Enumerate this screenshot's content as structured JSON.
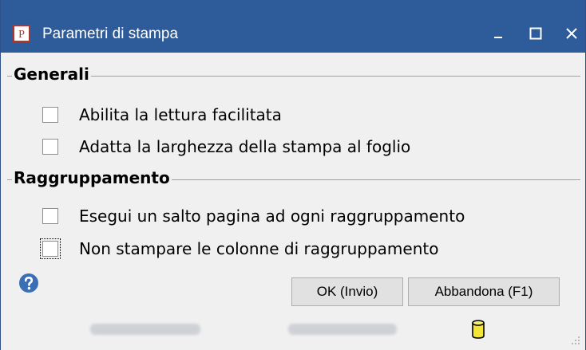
{
  "window": {
    "title": "Parametri di stampa",
    "app_icon_letter": "P",
    "controls": [
      "minimize",
      "maximize",
      "close"
    ]
  },
  "groups": [
    {
      "title": "Generali",
      "options": [
        {
          "label": "Abilita la lettura facilitata",
          "checked": false
        },
        {
          "label": "Adatta la larghezza della stampa al foglio",
          "checked": false
        }
      ]
    },
    {
      "title": "Raggruppamento",
      "options": [
        {
          "label": "Esegui un salto pagina ad ogni raggruppamento",
          "checked": false
        },
        {
          "label": "Non stampare le colonne di raggruppamento",
          "checked": false,
          "focused": true
        }
      ]
    }
  ],
  "buttons": {
    "ok_label": "OK (Invio)",
    "cancel_label": "Abbandona (F1)"
  },
  "icons": {
    "help": "help-icon",
    "status_database": "database-icon"
  },
  "colors": {
    "titlebar": "#2e5b9a",
    "window_bg": "#f0f0f0",
    "app_icon_red": "#b7322a",
    "help_blue": "#3a6fb5",
    "database_yellow": "#f2e536"
  }
}
